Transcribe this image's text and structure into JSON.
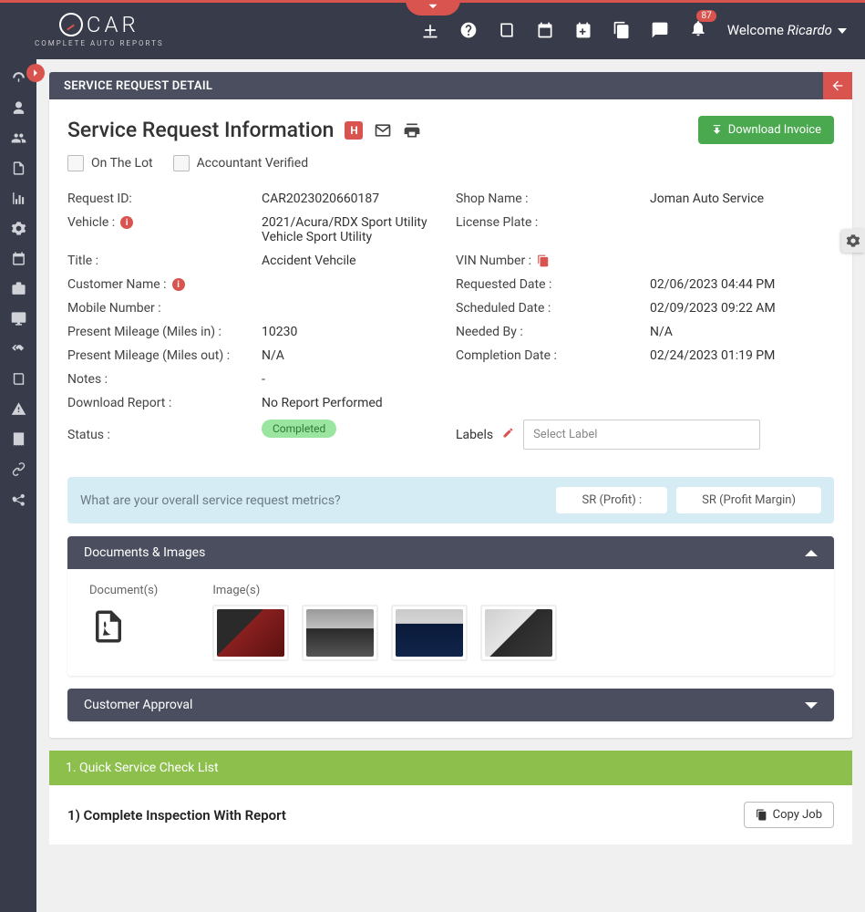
{
  "brand": {
    "name": "CAR",
    "sub": "COMPLETE AUTO REPORTS"
  },
  "header": {
    "notification_count": "87",
    "welcome_prefix": "Welcome ",
    "user_name": "Ricardo"
  },
  "page": {
    "title": "SERVICE REQUEST DETAIL",
    "heading": "Service Request Information",
    "download_btn": "Download Invoice",
    "checkbox_on_lot": "On The Lot",
    "checkbox_accountant": "Accountant Verified"
  },
  "fields": {
    "request_id_label": "Request ID:",
    "request_id_value": "CAR2023020660187",
    "shop_label": "Shop Name :",
    "shop_value": "Joman Auto Service",
    "vehicle_label": "Vehicle :",
    "vehicle_value": "2021/Acura/RDX Sport Utility Vehicle Sport Utility",
    "license_label": "License Plate :",
    "license_value": "",
    "title_label": "Title :",
    "title_value": "Accident Vehcile",
    "vin_label": "VIN Number :",
    "vin_value": "",
    "customer_label": "Customer Name :",
    "customer_value": "",
    "requested_label": "Requested Date :",
    "requested_value": "02/06/2023 04:44 PM",
    "mobile_label": "Mobile Number :",
    "mobile_value": "",
    "scheduled_label": "Scheduled Date :",
    "scheduled_value": "02/09/2023 09:22 AM",
    "miles_in_label": "Present Mileage (Miles in) :",
    "miles_in_value": "10230",
    "needed_label": "Needed By :",
    "needed_value": "N/A",
    "miles_out_label": "Present Mileage (Miles out) :",
    "miles_out_value": "N/A",
    "completion_label": "Completion Date :",
    "completion_value": "02/24/2023 01:19 PM",
    "notes_label": "Notes :",
    "notes_value": "-",
    "download_report_label": "Download Report :",
    "download_report_value": "No Report Performed",
    "status_label": "Status :",
    "status_value": "Completed",
    "labels_label": "Labels",
    "labels_placeholder": "Select Label"
  },
  "metrics": {
    "question": "What are your overall service request metrics?",
    "chip1": "SR (Profit) :",
    "chip2": "SR (Profit Margin)"
  },
  "panels": {
    "docs_title": "Documents & Images",
    "docs_sub1": "Document(s)",
    "docs_sub2": "Image(s)",
    "approval_title": "Customer Approval",
    "quick_title": "1. Quick Service Check List",
    "job1_title": "1) Complete Inspection With Report",
    "copy_job": "Copy Job"
  }
}
